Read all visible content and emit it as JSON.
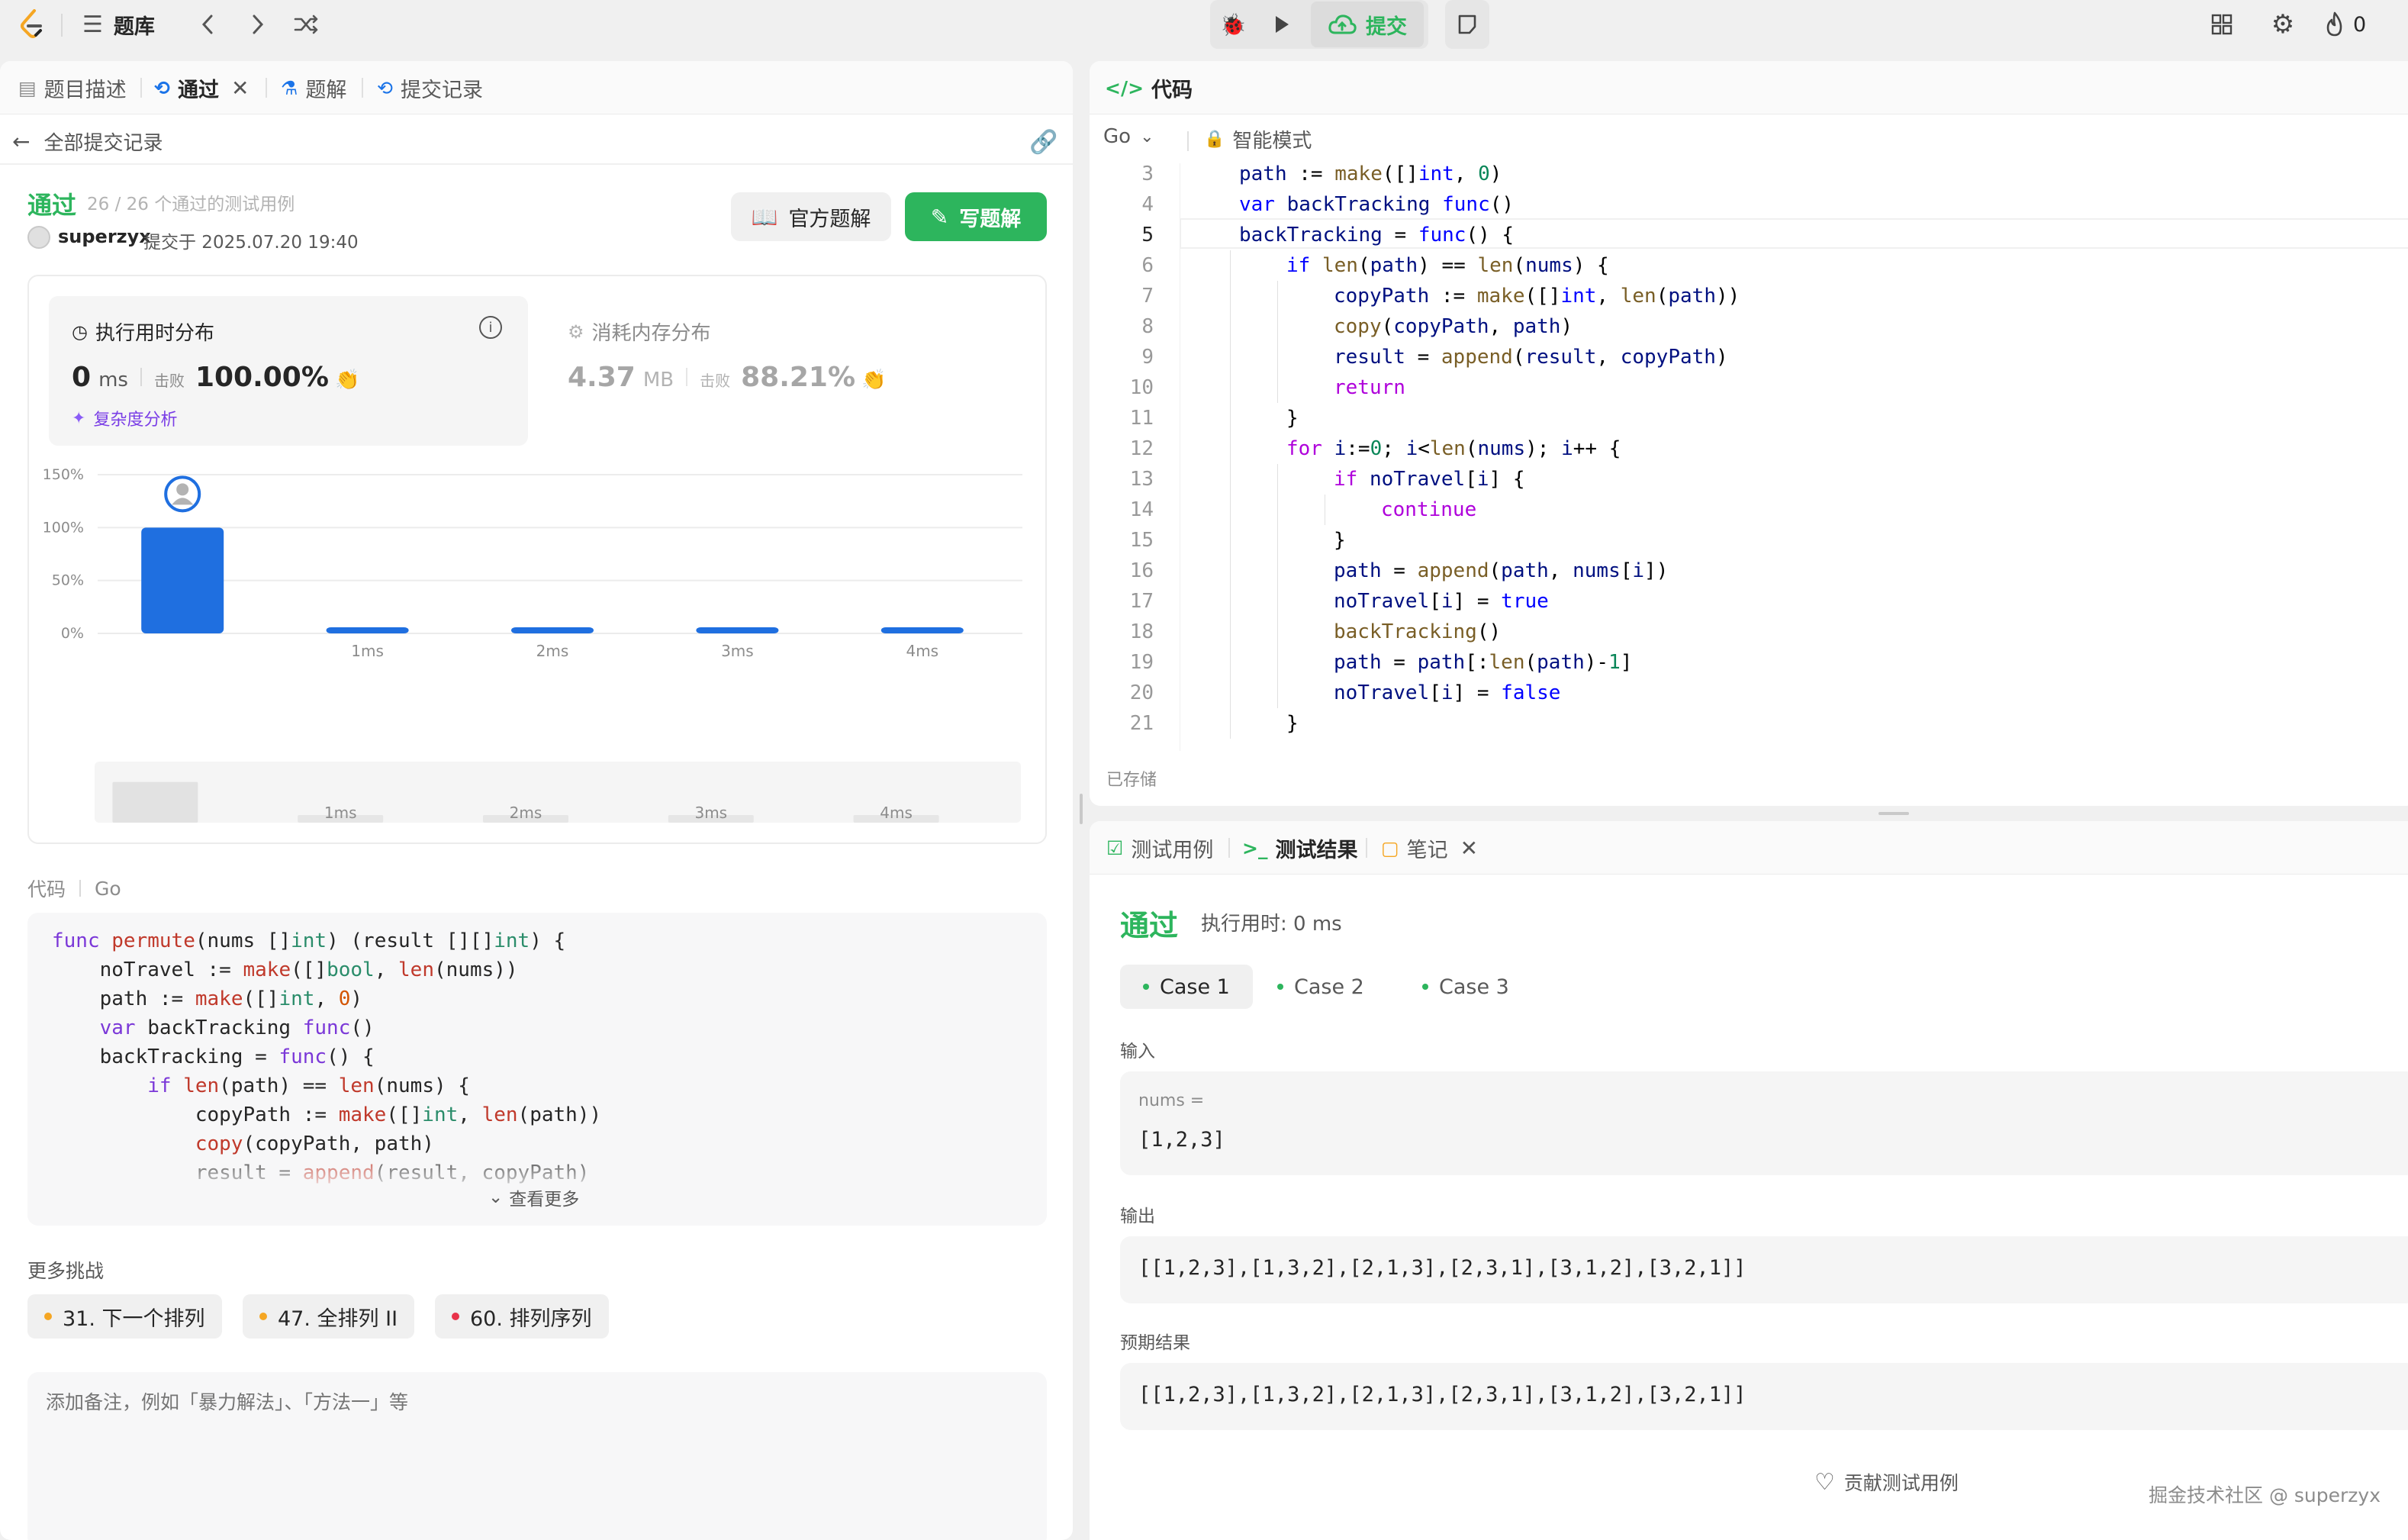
{
  "topbar": {
    "problem_list_label": "题库",
    "submit_label": "提交",
    "streak_count": "0"
  },
  "left": {
    "tabs": [
      {
        "label": "题目描述"
      },
      {
        "label": "通过"
      },
      {
        "label": "题解"
      },
      {
        "label": "提交记录"
      }
    ],
    "back_label": "全部提交记录",
    "status": "通过",
    "testcases": "26 / 26 个通过的测试用例",
    "user": "superzyx",
    "submitted_at": "提交于 2025.07.20 19:40",
    "official_solution_label": "官方题解",
    "write_solution_label": "写题解",
    "runtime": {
      "title": "执行用时分布",
      "value": "0",
      "unit": "ms",
      "beats_label": "击败",
      "beats": "100.00%",
      "complexity_label": "复杂度分析"
    },
    "memory": {
      "title": "消耗内存分布",
      "value": "4.37",
      "unit": "MB",
      "beats_label": "击败",
      "beats": "88.21%"
    },
    "code_label": "代码",
    "code_lang": "Go",
    "code_lines": [
      "func permute(nums []int) (result [][]int) {",
      "    noTravel := make([]bool, len(nums))",
      "    path := make([]int, 0)",
      "    var backTracking func()",
      "    backTracking = func() {",
      "        if len(path) == len(nums) {",
      "            copyPath := make([]int, len(path))",
      "            copy(copyPath, path)",
      "            result = append(result, copyPath)"
    ],
    "see_more_label": "查看更多",
    "more_challenges_label": "更多挑战",
    "challenges": [
      {
        "label": "31. 下一个排列",
        "color": "#f5a623"
      },
      {
        "label": "47. 全排列 II",
        "color": "#f5a623"
      },
      {
        "label": "60. 排列序列",
        "color": "#e8334a"
      }
    ],
    "notes_placeholder": "添加备注，例如「暴力解法」、「方法一」等"
  },
  "chart_data": {
    "type": "bar",
    "categories": [
      "0ms",
      "1ms",
      "2ms",
      "3ms",
      "4ms"
    ],
    "x_tick_labels": [
      "",
      "1ms",
      "2ms",
      "3ms",
      "4ms"
    ],
    "values": [
      100,
      2,
      2,
      2,
      2
    ],
    "ytick_labels": [
      "150%",
      "100%",
      "50%",
      "0%"
    ],
    "ylim": [
      0,
      150
    ],
    "highlight_index": 0,
    "highlight_color": "#1f6fe0",
    "grid": true,
    "minimap_labels": [
      "1ms",
      "2ms",
      "3ms",
      "4ms"
    ]
  },
  "editor": {
    "title": "代码",
    "lang": "Go",
    "mode": "智能模式",
    "saved": "已存储",
    "lines": [
      {
        "n": "3",
        "indent": 1,
        "tokens": [
          [
            "ev",
            "path"
          ],
          [
            "ed",
            " := "
          ],
          [
            "ef",
            "make"
          ],
          [
            "ed",
            "([]"
          ],
          [
            "ek",
            "int"
          ],
          [
            "ed",
            ", "
          ],
          [
            "en",
            "0"
          ],
          [
            "ed",
            ")"
          ]
        ]
      },
      {
        "n": "4",
        "indent": 1,
        "tokens": [
          [
            "ek",
            "var"
          ],
          [
            "ed",
            " "
          ],
          [
            "ev",
            "backTracking"
          ],
          [
            "ed",
            " "
          ],
          [
            "ek",
            "func"
          ],
          [
            "ed",
            "()"
          ]
        ]
      },
      {
        "n": "5",
        "indent": 1,
        "tokens": [
          [
            "ev",
            "backTracking"
          ],
          [
            "ed",
            " = "
          ],
          [
            "ek",
            "func"
          ],
          [
            "ed",
            "() {"
          ]
        ]
      },
      {
        "n": "6",
        "indent": 2,
        "tokens": [
          [
            "ek",
            "if"
          ],
          [
            "ed",
            " "
          ],
          [
            "ef",
            "len"
          ],
          [
            "ed",
            "("
          ],
          [
            "ev",
            "path"
          ],
          [
            "ed",
            ") == "
          ],
          [
            "ef",
            "len"
          ],
          [
            "ed",
            "("
          ],
          [
            "ev",
            "nums"
          ],
          [
            "ed",
            ") {"
          ]
        ]
      },
      {
        "n": "7",
        "indent": 3,
        "tokens": [
          [
            "ev",
            "copyPath"
          ],
          [
            "ed",
            " := "
          ],
          [
            "ef",
            "make"
          ],
          [
            "ed",
            "([]"
          ],
          [
            "ek",
            "int"
          ],
          [
            "ed",
            ", "
          ],
          [
            "ef",
            "len"
          ],
          [
            "ed",
            "("
          ],
          [
            "ev",
            "path"
          ],
          [
            "ed",
            "))"
          ]
        ]
      },
      {
        "n": "8",
        "indent": 3,
        "tokens": [
          [
            "ef",
            "copy"
          ],
          [
            "ed",
            "("
          ],
          [
            "ev",
            "copyPath"
          ],
          [
            "ed",
            ", "
          ],
          [
            "ev",
            "path"
          ],
          [
            "ed",
            ")"
          ]
        ]
      },
      {
        "n": "9",
        "indent": 3,
        "tokens": [
          [
            "ev",
            "result"
          ],
          [
            "ed",
            " = "
          ],
          [
            "ef",
            "append"
          ],
          [
            "ed",
            "("
          ],
          [
            "ev",
            "result"
          ],
          [
            "ed",
            ", "
          ],
          [
            "ev",
            "copyPath"
          ],
          [
            "ed",
            ")"
          ]
        ]
      },
      {
        "n": "10",
        "indent": 3,
        "tokens": [
          [
            "ec",
            "return"
          ]
        ]
      },
      {
        "n": "11",
        "indent": 2,
        "tokens": [
          [
            "ed",
            "}"
          ]
        ]
      },
      {
        "n": "12",
        "indent": 2,
        "tokens": [
          [
            "ec",
            "for"
          ],
          [
            "ed",
            " "
          ],
          [
            "ev",
            "i"
          ],
          [
            "ed",
            ":="
          ],
          [
            "en",
            "0"
          ],
          [
            "ed",
            "; "
          ],
          [
            "ev",
            "i"
          ],
          [
            "ed",
            "<"
          ],
          [
            "ef",
            "len"
          ],
          [
            "ed",
            "("
          ],
          [
            "ev",
            "nums"
          ],
          [
            "ed",
            "); "
          ],
          [
            "ev",
            "i"
          ],
          [
            "ed",
            "++ {"
          ]
        ]
      },
      {
        "n": "13",
        "indent": 3,
        "tokens": [
          [
            "ec",
            "if"
          ],
          [
            "ed",
            " "
          ],
          [
            "ev",
            "noTravel"
          ],
          [
            "ed",
            "["
          ],
          [
            "ev",
            "i"
          ],
          [
            "ed",
            "] {"
          ]
        ]
      },
      {
        "n": "14",
        "indent": 4,
        "tokens": [
          [
            "ec",
            "continue"
          ]
        ]
      },
      {
        "n": "15",
        "indent": 3,
        "tokens": [
          [
            "ed",
            "}"
          ]
        ]
      },
      {
        "n": "16",
        "indent": 3,
        "tokens": [
          [
            "ev",
            "path"
          ],
          [
            "ed",
            " = "
          ],
          [
            "ef",
            "append"
          ],
          [
            "ed",
            "("
          ],
          [
            "ev",
            "path"
          ],
          [
            "ed",
            ", "
          ],
          [
            "ev",
            "nums"
          ],
          [
            "ed",
            "["
          ],
          [
            "ev",
            "i"
          ],
          [
            "ed",
            "])"
          ]
        ]
      },
      {
        "n": "17",
        "indent": 3,
        "tokens": [
          [
            "ev",
            "noTravel"
          ],
          [
            "ed",
            "["
          ],
          [
            "ev",
            "i"
          ],
          [
            "ed",
            "] = "
          ],
          [
            "ek",
            "true"
          ]
        ]
      },
      {
        "n": "18",
        "indent": 3,
        "tokens": [
          [
            "ef",
            "backTracking"
          ],
          [
            "ed",
            "()"
          ]
        ]
      },
      {
        "n": "19",
        "indent": 3,
        "tokens": [
          [
            "ev",
            "path"
          ],
          [
            "ed",
            " = "
          ],
          [
            "ev",
            "path"
          ],
          [
            "ed",
            "[:"
          ],
          [
            "ef",
            "len"
          ],
          [
            "ed",
            "("
          ],
          [
            "ev",
            "path"
          ],
          [
            "ed",
            ")-"
          ],
          [
            "en",
            "1"
          ],
          [
            "ed",
            "]"
          ]
        ]
      },
      {
        "n": "20",
        "indent": 3,
        "tokens": [
          [
            "ev",
            "noTravel"
          ],
          [
            "ed",
            "["
          ],
          [
            "ev",
            "i"
          ],
          [
            "ed",
            "] = "
          ],
          [
            "ek",
            "false"
          ]
        ]
      },
      {
        "n": "21",
        "indent": 2,
        "tokens": [
          [
            "ed",
            "}"
          ]
        ]
      }
    ]
  },
  "bottom": {
    "tabs": [
      {
        "label": "测试用例"
      },
      {
        "label": "测试结果"
      },
      {
        "label": "笔记"
      }
    ],
    "status": "通过",
    "runtime": "执行用时: 0 ms",
    "cases": [
      "Case 1",
      "Case 2",
      "Case 3"
    ],
    "input_label": "输入",
    "input_var": "nums =",
    "input_value": "[1,2,3]",
    "output_label": "输出",
    "output_value": "[[1,2,3],[1,3,2],[2,1,3],[2,3,1],[3,1,2],[3,2,1]]",
    "expected_label": "预期结果",
    "expected_value": "[[1,2,3],[1,3,2],[2,1,3],[2,3,1],[3,1,2],[3,2,1]]",
    "contribute_label": "贡献测试用例",
    "watermark": "掘金技术社区 @ superzyx"
  }
}
